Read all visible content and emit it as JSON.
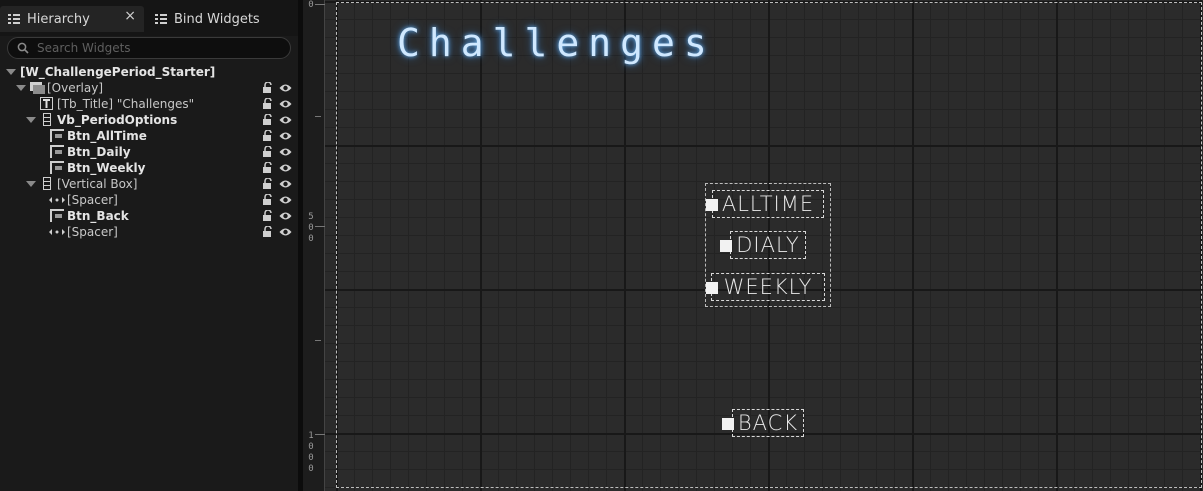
{
  "tabs": [
    {
      "label": "Hierarchy",
      "close": "×"
    },
    {
      "label": "Bind Widgets"
    }
  ],
  "search": {
    "placeholder": "Search Widgets"
  },
  "tree": [
    {
      "prefix": "",
      "name": "[W_ChallengePeriod_Starter]",
      "bold": true
    },
    {
      "prefix": "",
      "name": "[Overlay]",
      "bold": false
    },
    {
      "prefix": "[Tb_Title] ",
      "name": "\"Challenges\"",
      "bold": false
    },
    {
      "prefix": "",
      "name": "Vb_PeriodOptions",
      "bold": true
    },
    {
      "prefix": "",
      "name": "Btn_AllTime",
      "bold": true
    },
    {
      "prefix": "",
      "name": "Btn_Daily",
      "bold": true
    },
    {
      "prefix": "",
      "name": "Btn_Weekly",
      "bold": true
    },
    {
      "prefix": "",
      "name": "[Vertical Box]",
      "bold": false
    },
    {
      "prefix": "",
      "name": "[Spacer]",
      "bold": false
    },
    {
      "prefix": "",
      "name": "Btn_Back",
      "bold": true
    },
    {
      "prefix": "",
      "name": "[Spacer]",
      "bold": false
    }
  ],
  "ruler": {
    "top": "0",
    "mid": [
      "5",
      "0",
      "0"
    ],
    "bottom": [
      "1",
      "0",
      "0",
      "0"
    ]
  },
  "designer": {
    "title": "Challenges",
    "buttons": {
      "alltime": "ALLTIME",
      "daily": "DIALY",
      "weekly": "WEEKLY",
      "back": "BACK"
    }
  },
  "colors": {
    "title_glow": "#6aaee8",
    "title_text": "#cfe8ff",
    "panel_bg": "#1a1a1a",
    "canvas_bg": "#2b2b2b"
  }
}
